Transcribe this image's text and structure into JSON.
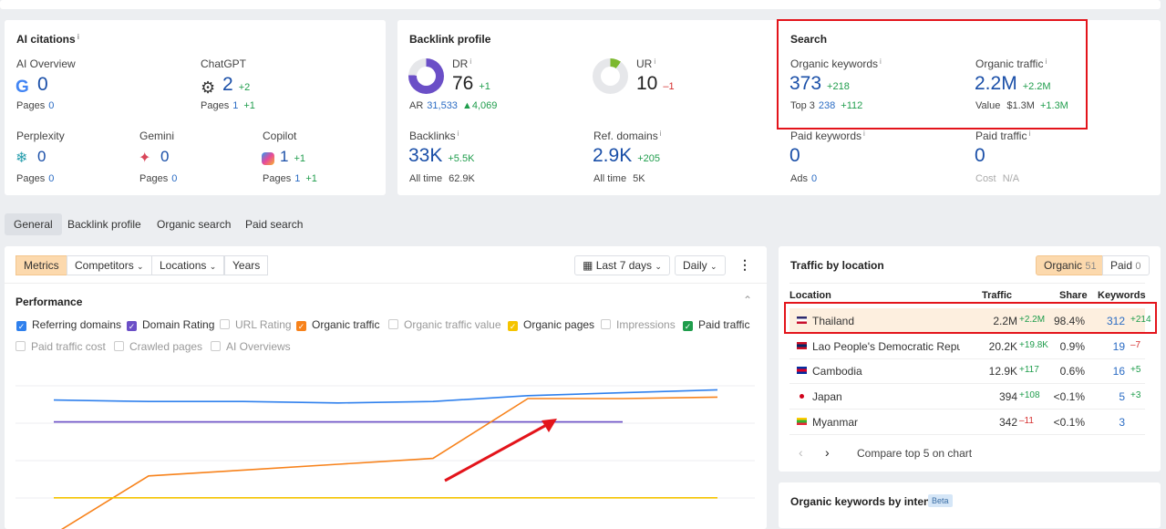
{
  "ai_citations": {
    "title": "AI citations",
    "items": [
      {
        "name": "AI Overview",
        "icon": "google-icon",
        "value": "0",
        "delta": "",
        "pages": "0",
        "pages_delta": ""
      },
      {
        "name": "ChatGPT",
        "icon": "chatgpt-icon",
        "value": "2",
        "delta": "+2",
        "pages": "1",
        "pages_delta": "+1"
      },
      {
        "name": "Perplexity",
        "icon": "perplexity-icon",
        "value": "0",
        "delta": "",
        "pages": "0",
        "pages_delta": ""
      },
      {
        "name": "Gemini",
        "icon": "gemini-icon",
        "value": "0",
        "delta": "",
        "pages": "0",
        "pages_delta": ""
      },
      {
        "name": "Copilot",
        "icon": "copilot-icon",
        "value": "1",
        "delta": "+1",
        "pages": "1",
        "pages_delta": "+1"
      }
    ],
    "pages_label": "Pages"
  },
  "backlink": {
    "title": "Backlink profile",
    "dr_label": "DR",
    "dr": "76",
    "dr_delta": "+1",
    "dr_fill": 76,
    "ur_label": "UR",
    "ur": "10",
    "ur_delta": "–1",
    "ur_fill": 10,
    "ar_label": "AR",
    "ar": "31,533",
    "ar_delta": "▲4,069",
    "backlinks_label": "Backlinks",
    "backlinks": "33K",
    "backlinks_delta": "+5.5K",
    "backlinks_alltime_label": "All time",
    "backlinks_alltime": "62.9K",
    "refdomains_label": "Ref. domains",
    "refdomains": "2.9K",
    "refdomains_delta": "+205",
    "refdomains_alltime_label": "All time",
    "refdomains_alltime": "5K"
  },
  "search": {
    "title": "Search",
    "ok_label": "Organic keywords",
    "ok": "373",
    "ok_delta": "+218",
    "top3_label": "Top 3",
    "top3": "238",
    "top3_delta": "+112",
    "ot_label": "Organic traffic",
    "ot": "2.2M",
    "ot_delta": "+2.2M",
    "value_label": "Value",
    "value": "$1.3M",
    "value_delta": "+1.3M",
    "pk_label": "Paid keywords",
    "pk": "0",
    "ads_label": "Ads",
    "ads": "0",
    "pt_label": "Paid traffic",
    "pt": "0",
    "cost_label": "Cost",
    "cost": "N/A"
  },
  "tabs": [
    "General",
    "Backlink profile",
    "Organic search",
    "Paid search"
  ],
  "toolbar": {
    "metrics": "Metrics",
    "competitors": "Competitors",
    "locations": "Locations",
    "years": "Years",
    "range": "Last 7 days",
    "interval": "Daily"
  },
  "performance": {
    "title": "Performance",
    "checks": [
      {
        "label": "Referring domains",
        "checked": true,
        "color": "#2f80ed"
      },
      {
        "label": "Domain Rating",
        "checked": true,
        "color": "#6b4fc7"
      },
      {
        "label": "URL Rating",
        "checked": false
      },
      {
        "label": "Organic traffic",
        "checked": true,
        "color": "#f7821b"
      },
      {
        "label": "Organic traffic value",
        "checked": false
      },
      {
        "label": "Organic pages",
        "checked": true,
        "color": "#f5c400"
      },
      {
        "label": "Impressions",
        "checked": false
      },
      {
        "label": "Paid traffic",
        "checked": true,
        "color": "#1f9d4c"
      },
      {
        "label": "Paid traffic cost",
        "checked": false
      },
      {
        "label": "Crawled pages",
        "checked": false
      },
      {
        "label": "AI Overviews",
        "checked": false
      }
    ]
  },
  "chart_data": {
    "type": "line",
    "x": [
      0,
      1,
      2,
      3,
      4,
      5,
      6,
      7
    ],
    "grid": true,
    "series": [
      {
        "color": "#2f80ed",
        "values": [
          84,
          83,
          83,
          82,
          83,
          87,
          89,
          91
        ]
      },
      {
        "color": "#6b4fc7",
        "values": [
          69,
          69,
          69,
          69,
          69,
          69,
          69,
          null
        ]
      },
      {
        "color": "#f7821b",
        "values": [
          -8,
          32,
          36,
          40,
          44,
          85,
          85,
          86
        ]
      },
      {
        "color": "#f5c400",
        "values": [
          17,
          17,
          17,
          17,
          17,
          17,
          17,
          17
        ]
      }
    ]
  },
  "traffic_by_location": {
    "title": "Traffic by location",
    "organic_label": "Organic",
    "organic_count": "51",
    "paid_label": "Paid",
    "paid_count": "0",
    "columns": [
      "Location",
      "Traffic",
      "Share",
      "Keywords"
    ],
    "rows": [
      {
        "country": "Thailand",
        "traffic": "2.2M",
        "traffic_delta": "+2.2M",
        "share": "98.4%",
        "keywords": "312",
        "kw_delta": "+214"
      },
      {
        "country": "Lao People's Democratic Reput",
        "traffic": "20.2K",
        "traffic_delta": "+19.8K",
        "share": "0.9%",
        "keywords": "19",
        "kw_delta": "–7"
      },
      {
        "country": "Cambodia",
        "traffic": "12.9K",
        "traffic_delta": "+117",
        "share": "0.6%",
        "keywords": "16",
        "kw_delta": "+5"
      },
      {
        "country": "Japan",
        "traffic": "394",
        "traffic_delta": "+108",
        "share": "<0.1%",
        "keywords": "5",
        "kw_delta": "+3"
      },
      {
        "country": "Myanmar",
        "traffic": "342",
        "traffic_delta": "–11",
        "share": "<0.1%",
        "keywords": "3",
        "kw_delta": ""
      }
    ],
    "compare": "Compare top 5 on chart"
  },
  "intent": {
    "title": "Organic keywords by intent",
    "badge": "Beta"
  }
}
